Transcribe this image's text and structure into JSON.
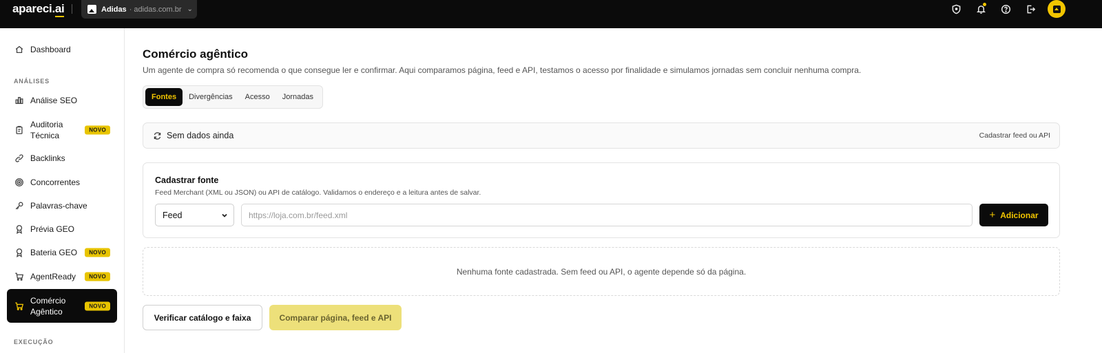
{
  "topbar": {
    "logo_main": "apareci.",
    "logo_ai": "ai",
    "site": {
      "name": "Adidas",
      "domain": "· adidas.com.br"
    },
    "icons": [
      "shield-icon",
      "bell-icon",
      "help-icon",
      "logout-icon"
    ],
    "accent_color": "#f2c500"
  },
  "sidebar": {
    "dashboard": "Dashboard",
    "section_analises": "ANÁLISES",
    "section_execucao": "EXECUÇÃO",
    "badge_label": "NOVO",
    "items": [
      {
        "label": "Análise SEO",
        "icon": "bar-chart-icon",
        "badge": false
      },
      {
        "label": "Auditoria Técnica",
        "icon": "clipboard-icon",
        "badge": true
      },
      {
        "label": "Backlinks",
        "icon": "link-icon",
        "badge": false
      },
      {
        "label": "Concorrentes",
        "icon": "target-icon",
        "badge": false
      },
      {
        "label": "Palavras-chave",
        "icon": "key-icon",
        "badge": false
      },
      {
        "label": "Prévia GEO",
        "icon": "award-icon",
        "badge": false
      },
      {
        "label": "Bateria GEO",
        "icon": "award-icon",
        "badge": true
      },
      {
        "label": "AgentReady",
        "icon": "cart-icon",
        "badge": true
      },
      {
        "label": "Comércio Agêntico",
        "icon": "cart-icon",
        "badge": true,
        "active": true
      }
    ]
  },
  "main": {
    "title": "Comércio agêntico",
    "description": "Um agente de compra só recomenda o que consegue ler e confirmar. Aqui comparamos página, feed e API, testamos o acesso por finalidade e simulamos jornadas sem concluir nenhuma compra.",
    "tabs": [
      {
        "label": "Fontes",
        "active": true
      },
      {
        "label": "Divergências",
        "active": false
      },
      {
        "label": "Acesso",
        "active": false
      },
      {
        "label": "Jornadas",
        "active": false
      }
    ],
    "status": {
      "text": "Sem dados ainda",
      "link": "Cadastrar feed ou API"
    },
    "card": {
      "title": "Cadastrar fonte",
      "description": "Feed Merchant (XML ou JSON) ou API de catálogo. Validamos o endereço e a leitura antes de salvar.",
      "source_type": "Feed",
      "url_value": "",
      "url_placeholder": "https://loja.com.br/feed.xml",
      "add_button": "Adicionar"
    },
    "empty_message": "Nenhuma fonte cadastrada. Sem feed ou API, o agente depende só da página.",
    "verify_button": "Verificar catálogo e faixa",
    "compare_button": "Comparar página, feed e API"
  }
}
